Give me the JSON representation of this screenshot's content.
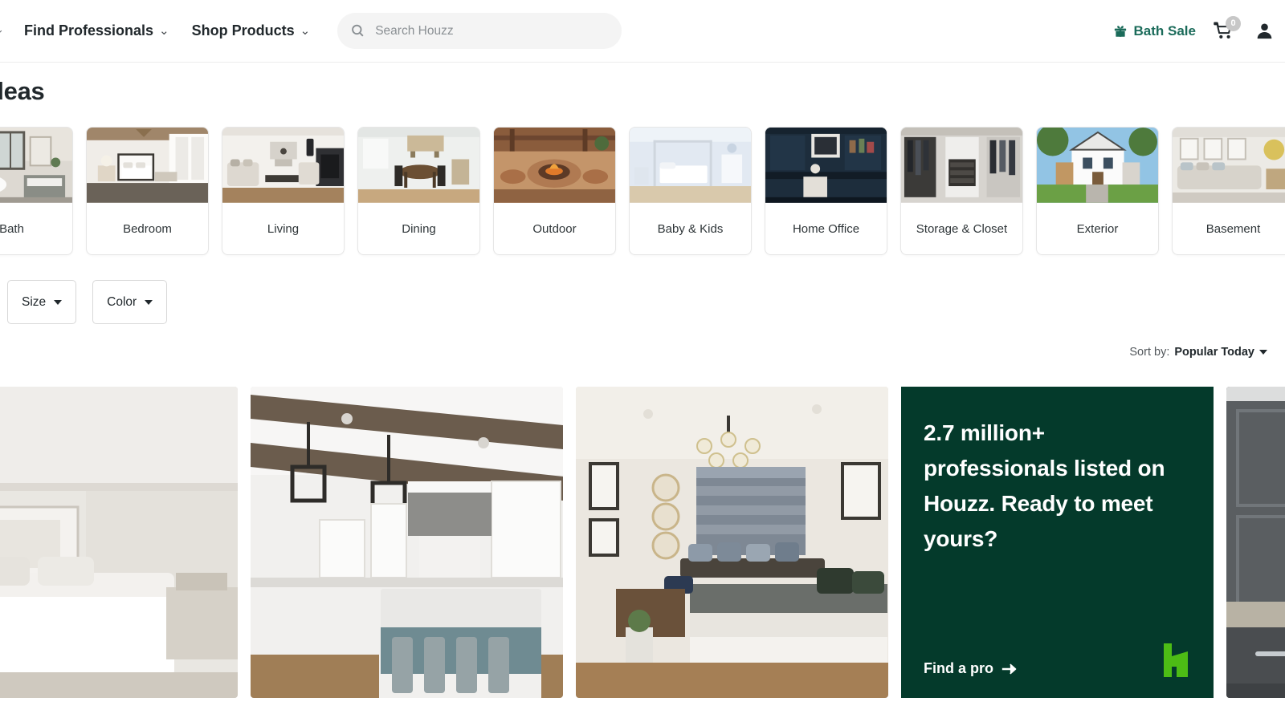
{
  "header": {
    "nav": [
      {
        "label": "Find Professionals",
        "icon": "chevron-down-icon"
      },
      {
        "label": "Shop Products",
        "icon": "chevron-down-icon"
      }
    ],
    "search": {
      "placeholder": "Search Houzz",
      "value": "",
      "icon": "search-icon"
    },
    "promo_link": {
      "label": "Bath Sale",
      "icon": "gift-icon",
      "color": "#1b6b5a"
    },
    "cart": {
      "icon": "shopping-cart-icon",
      "count": "0"
    },
    "account": {
      "icon": "user-avatar-icon"
    }
  },
  "page": {
    "title": "deas"
  },
  "categories": [
    {
      "label": "Bath"
    },
    {
      "label": "Bedroom"
    },
    {
      "label": "Living"
    },
    {
      "label": "Dining"
    },
    {
      "label": "Outdoor"
    },
    {
      "label": "Baby & Kids"
    },
    {
      "label": "Home Office"
    },
    {
      "label": "Storage & Closet"
    },
    {
      "label": "Exterior"
    },
    {
      "label": "Basement"
    }
  ],
  "filters": [
    {
      "label": "Size",
      "icon": "caret-down-icon"
    },
    {
      "label": "Color",
      "icon": "caret-down-icon"
    }
  ],
  "sort": {
    "label": "Sort by:",
    "value": "Popular Today",
    "icon": "caret-down-icon"
  },
  "grid": {
    "tiles": [
      {
        "type": "photo",
        "alt": "bedroom-with-upholstered-bed"
      },
      {
        "type": "photo",
        "alt": "white-kitchen-with-wood-beams-and-island"
      },
      {
        "type": "photo",
        "alt": "bedroom-with-window-seat-and-chandelier"
      },
      {
        "type": "promo"
      },
      {
        "type": "photo",
        "alt": "dark-gray-kitchen-pantry"
      }
    ]
  },
  "promo_card": {
    "headline": "2.7 million+ professionals listed on Houzz. Ready to meet yours?",
    "cta": "Find a pro",
    "cta_icon": "arrow-right-icon",
    "logo_icon": "houzz-logo-icon",
    "background_color": "#043a2b",
    "logo_color": "#4dbc15"
  }
}
